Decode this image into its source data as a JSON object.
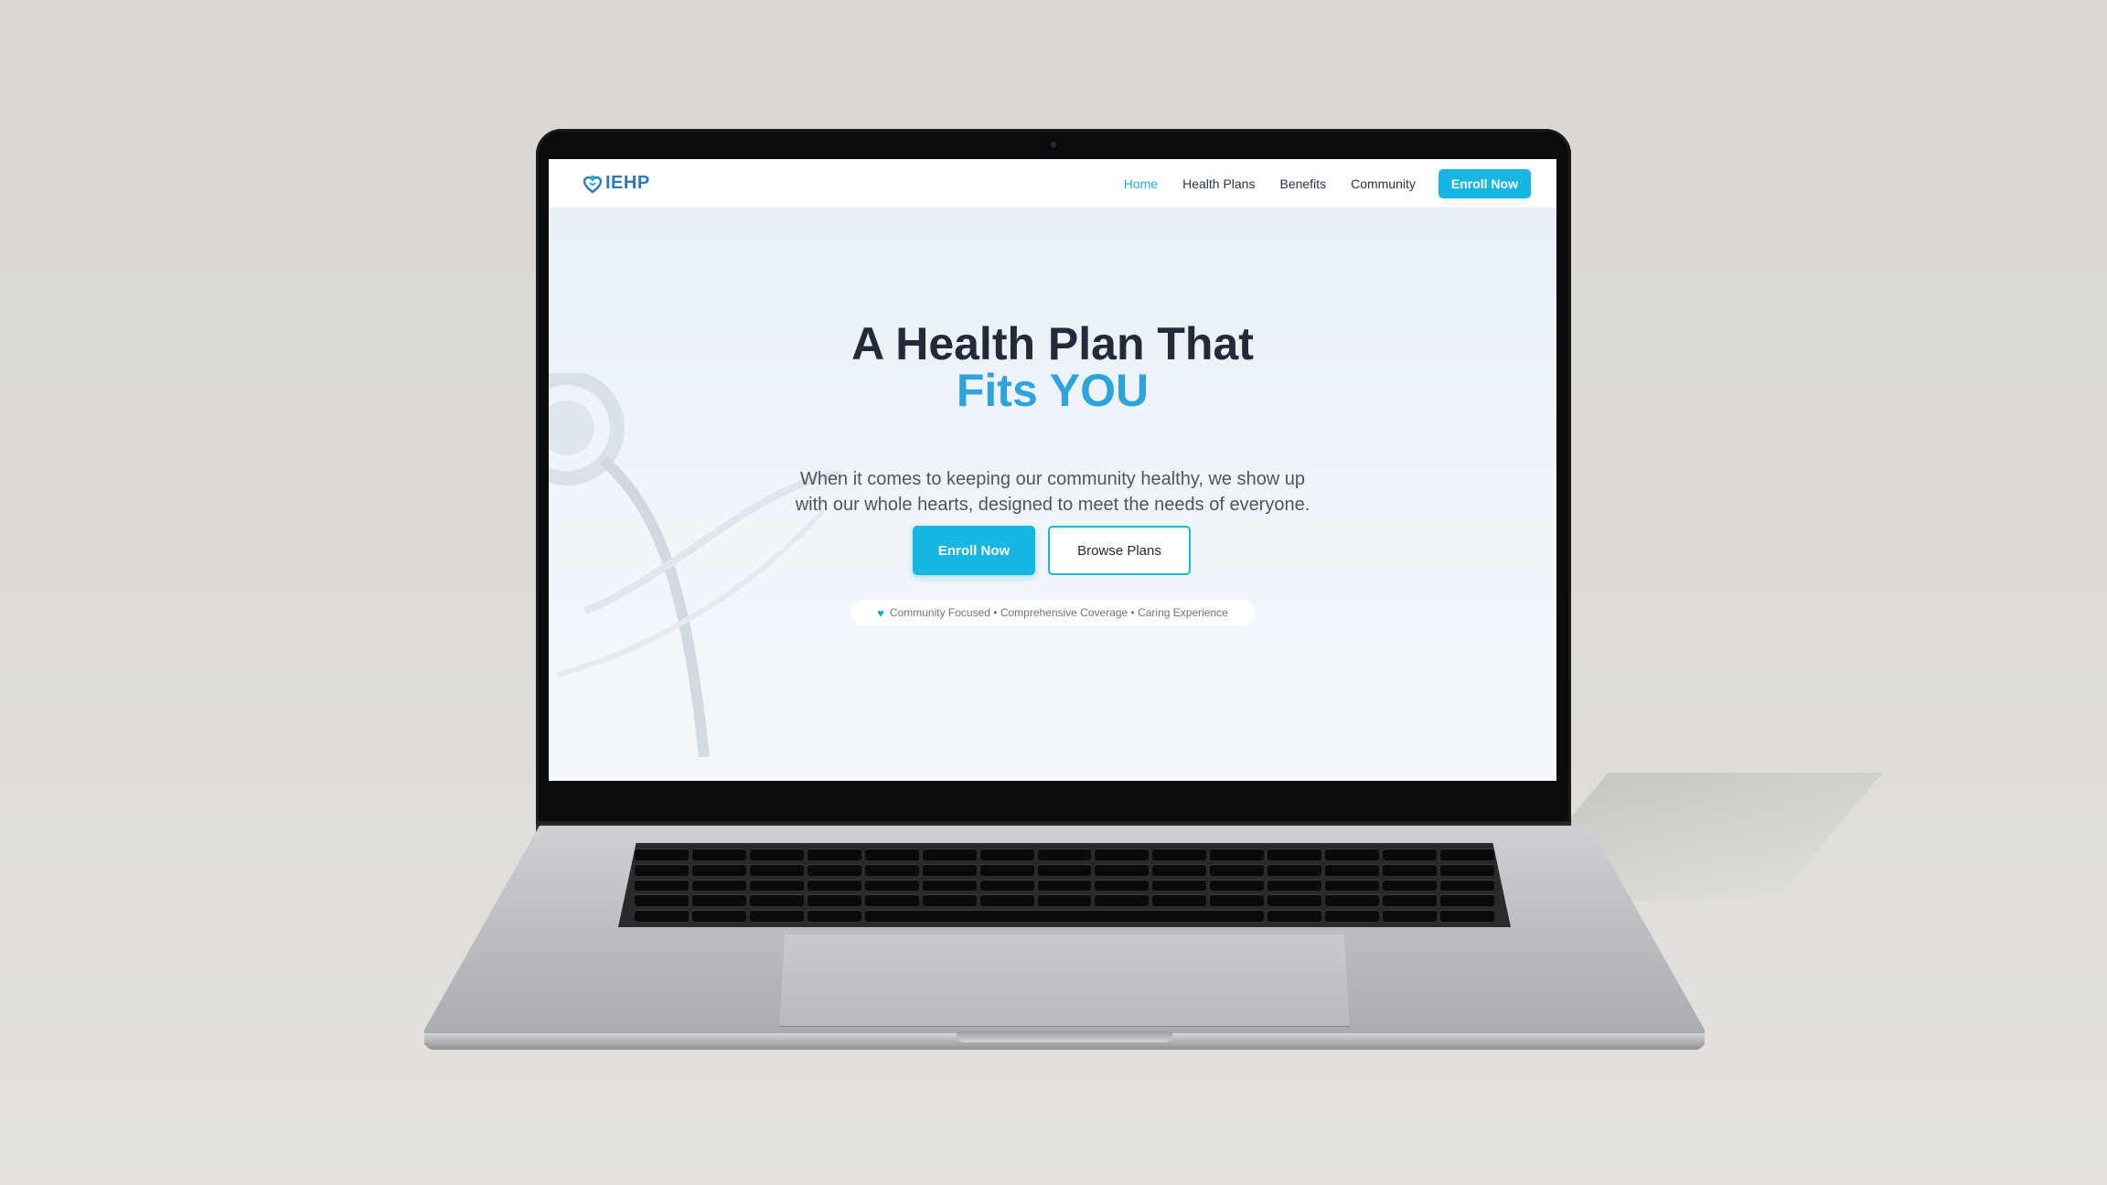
{
  "site": {
    "logo_text": "IEHP",
    "nav": [
      {
        "label": "Home",
        "active": true
      },
      {
        "label": "Health Plans",
        "active": false
      },
      {
        "label": "Benefits",
        "active": false
      },
      {
        "label": "Community",
        "active": false
      }
    ],
    "nav_cta": "Enroll Now"
  },
  "hero": {
    "title_line1": "A Health Plan That",
    "title_line2": "Fits YOU",
    "subtitle_line1": "When it comes to keeping our community healthy, we show up",
    "subtitle_line2": "with our whole hearts, designed to meet the needs of everyone.",
    "primary_button": "Enroll Now",
    "secondary_button": "Browse Plans",
    "tagline": "Community Focused • Comprehensive Coverage • Caring Experience"
  },
  "colors": {
    "accent": "#17b6e3",
    "title_highlight": "#2ea4dc",
    "logo": "#2f78b8",
    "heading": "#232b3a"
  },
  "icons": {
    "logo": "heart-person-icon",
    "tagline": "heart-icon",
    "background": "stethoscope-icon"
  }
}
